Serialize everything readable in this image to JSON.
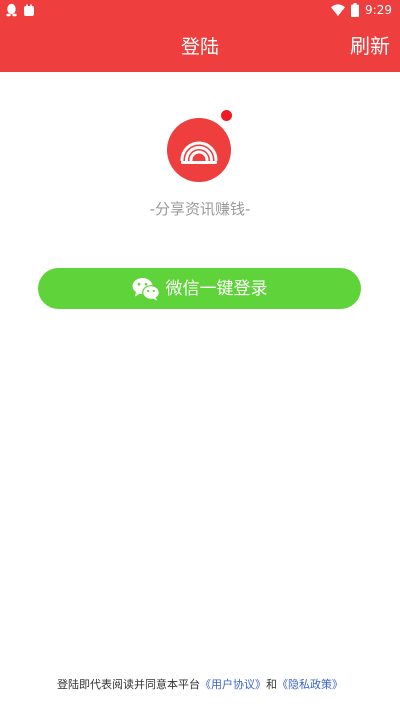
{
  "status_bar": {
    "time": "9:29",
    "icons": [
      "qq-icon",
      "notification-icon",
      "wifi-icon",
      "battery-icon"
    ]
  },
  "app_bar": {
    "title": "登陆",
    "refresh_label": "刷新"
  },
  "logo": {
    "icon": "app-logo-icon"
  },
  "slogan": "-分享资讯赚钱-",
  "wechat_login": {
    "label": "微信一键登录",
    "icon": "wechat-icon"
  },
  "footer": {
    "prefix": "登陆即代表阅读并同意本平台",
    "user_agreement": "《用户协议》",
    "conjunction": "和",
    "privacy_policy": "《隐私政策》"
  },
  "colors": {
    "primary": "#ee3e3e",
    "wechat_green": "#5fd33a",
    "link_blue": "#3a63c7",
    "slogan_gray": "#9a9a9a"
  }
}
